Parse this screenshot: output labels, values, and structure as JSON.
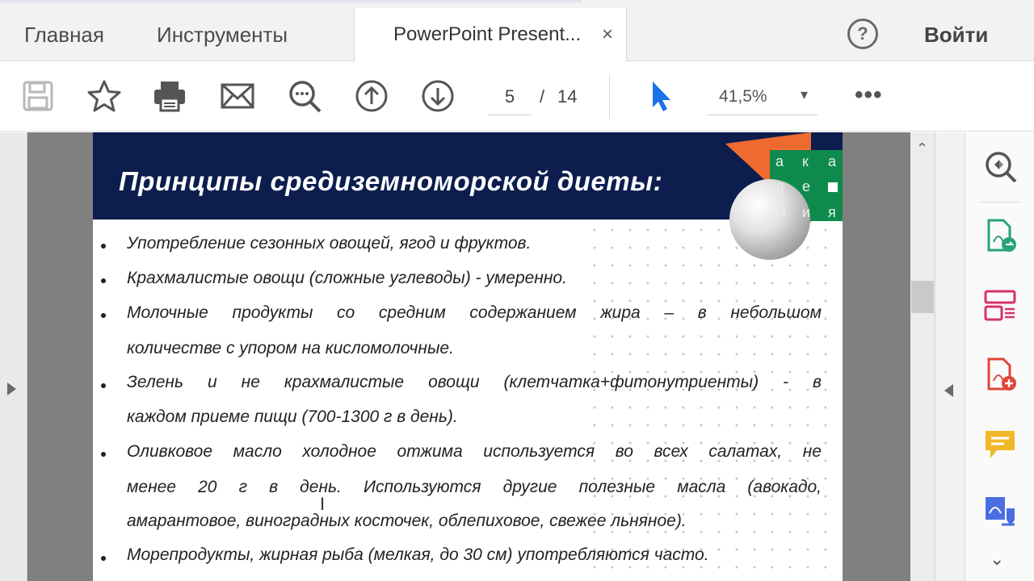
{
  "tabs": {
    "home": "Главная",
    "tools": "Инструменты",
    "document": "PowerPoint Present...",
    "close_glyph": "×"
  },
  "header": {
    "help_glyph": "?",
    "signin": "Войти"
  },
  "toolbar": {
    "icons": [
      "save-icon",
      "star-icon",
      "print-icon",
      "email-icon",
      "zoom-search-icon",
      "page-up-icon",
      "page-down-icon",
      "select-cursor-icon"
    ],
    "page_current": "5",
    "page_separator": "/",
    "page_total": "14",
    "zoom": "41,5%",
    "zoom_caret": "▾",
    "more": "•••"
  },
  "colors": {
    "slide_header": "#0c1d4e",
    "logo_orange": "#ef6a2f",
    "logo_green": "#0f8a4d",
    "cursor_blue": "#1a73e8"
  },
  "slide": {
    "title": "Принципы средиземноморской диеты:",
    "logo_letters": [
      "а",
      "к",
      "а",
      "д",
      "е",
      "м",
      "и",
      "я"
    ],
    "bullets": [
      {
        "lines": [
          "Употребление сезонных овощей, ягод и фруктов."
        ]
      },
      {
        "lines": [
          "Крахмалистые овощи (сложные углеводы) - умеренно."
        ]
      },
      {
        "lines": [
          "Молочные продукты со средним содержанием жира – в небольшом",
          "количестве с упором на кисломолочные."
        ]
      },
      {
        "lines": [
          "Зелень и не крахмалистые овощи (клетчатка+фитонутриенты) - в",
          "каждом приеме пищи (700-1300 г в день)."
        ]
      },
      {
        "lines": [
          "Оливковое масло холодное отжима используется во всех салатах, не",
          "менее 20 г в день. Используются другие полезные масла (авокадо,",
          "амарантовое, виноградных косточек, облепиховое, свежее льняное)."
        ]
      },
      {
        "lines": [
          "Морепродукты, жирная рыба (мелкая, до 30 см) употребляются часто."
        ]
      }
    ]
  },
  "scroll": {
    "up_glyph": "⌃"
  },
  "rightpanel": {
    "icons": [
      "zoom-fit-icon",
      "export-pdf-icon",
      "organize-pages-icon",
      "create-pdf-icon",
      "comment-icon",
      "edit-pdf-icon"
    ],
    "down_glyph": "⌄"
  }
}
